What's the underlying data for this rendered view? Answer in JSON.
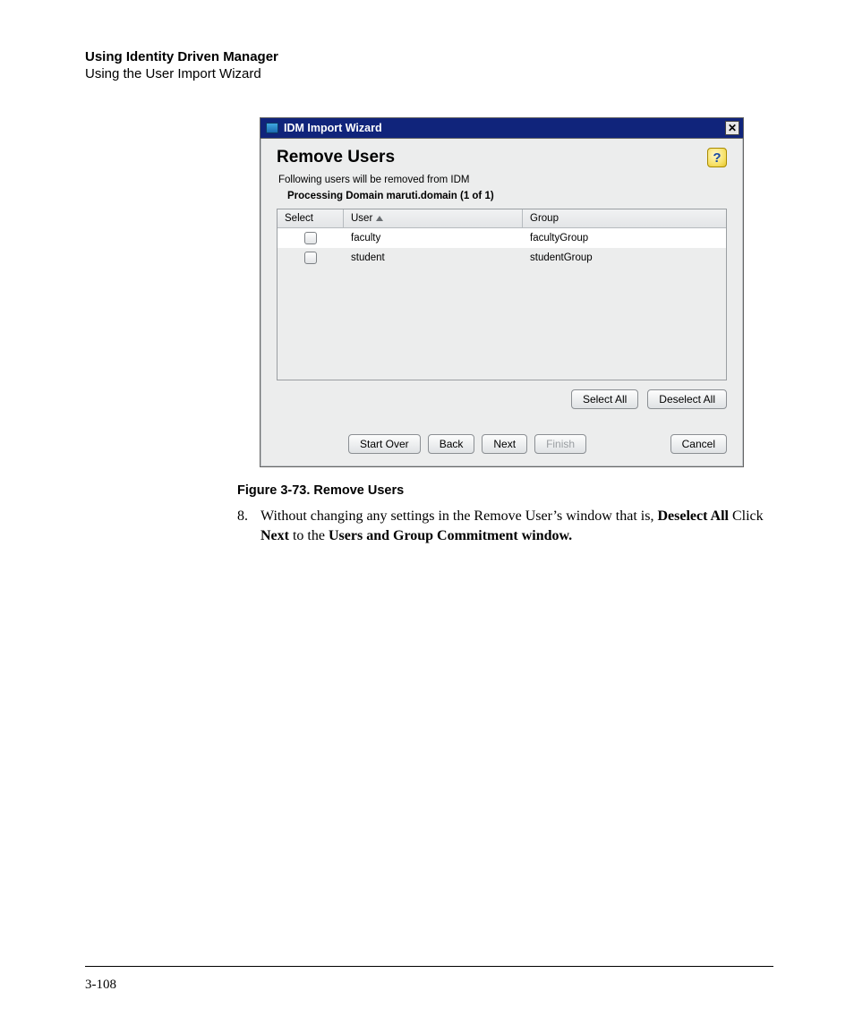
{
  "header": {
    "title": "Using Identity Driven Manager",
    "subtitle": "Using the User Import Wizard"
  },
  "dialog": {
    "window_title": "IDM Import Wizard",
    "heading": "Remove Users",
    "description": "Following users will be removed from IDM",
    "processing": "Processing Domain maruti.domain (1 of 1)",
    "columns": {
      "select": "Select",
      "user": "User",
      "group": "Group"
    },
    "rows": [
      {
        "user": "faculty",
        "group": "facultyGroup"
      },
      {
        "user": "student",
        "group": "studentGroup"
      }
    ],
    "buttons": {
      "select_all": "Select All",
      "deselect_all": "Deselect All",
      "start_over": "Start Over",
      "back": "Back",
      "next": "Next",
      "finish": "Finish",
      "cancel": "Cancel"
    },
    "help_glyph": "?",
    "close_glyph": "✕"
  },
  "caption": "Figure 3-73. Remove Users",
  "step": {
    "number": "8.",
    "text_pre": "Without changing any settings in the Remove User’s window that is, ",
    "bold1": "Deselect All",
    "mid1": " Click ",
    "bold2": "Next",
    "mid2": " to the ",
    "bold3": "Users and Group Commitment window."
  },
  "page_number": "3-108"
}
